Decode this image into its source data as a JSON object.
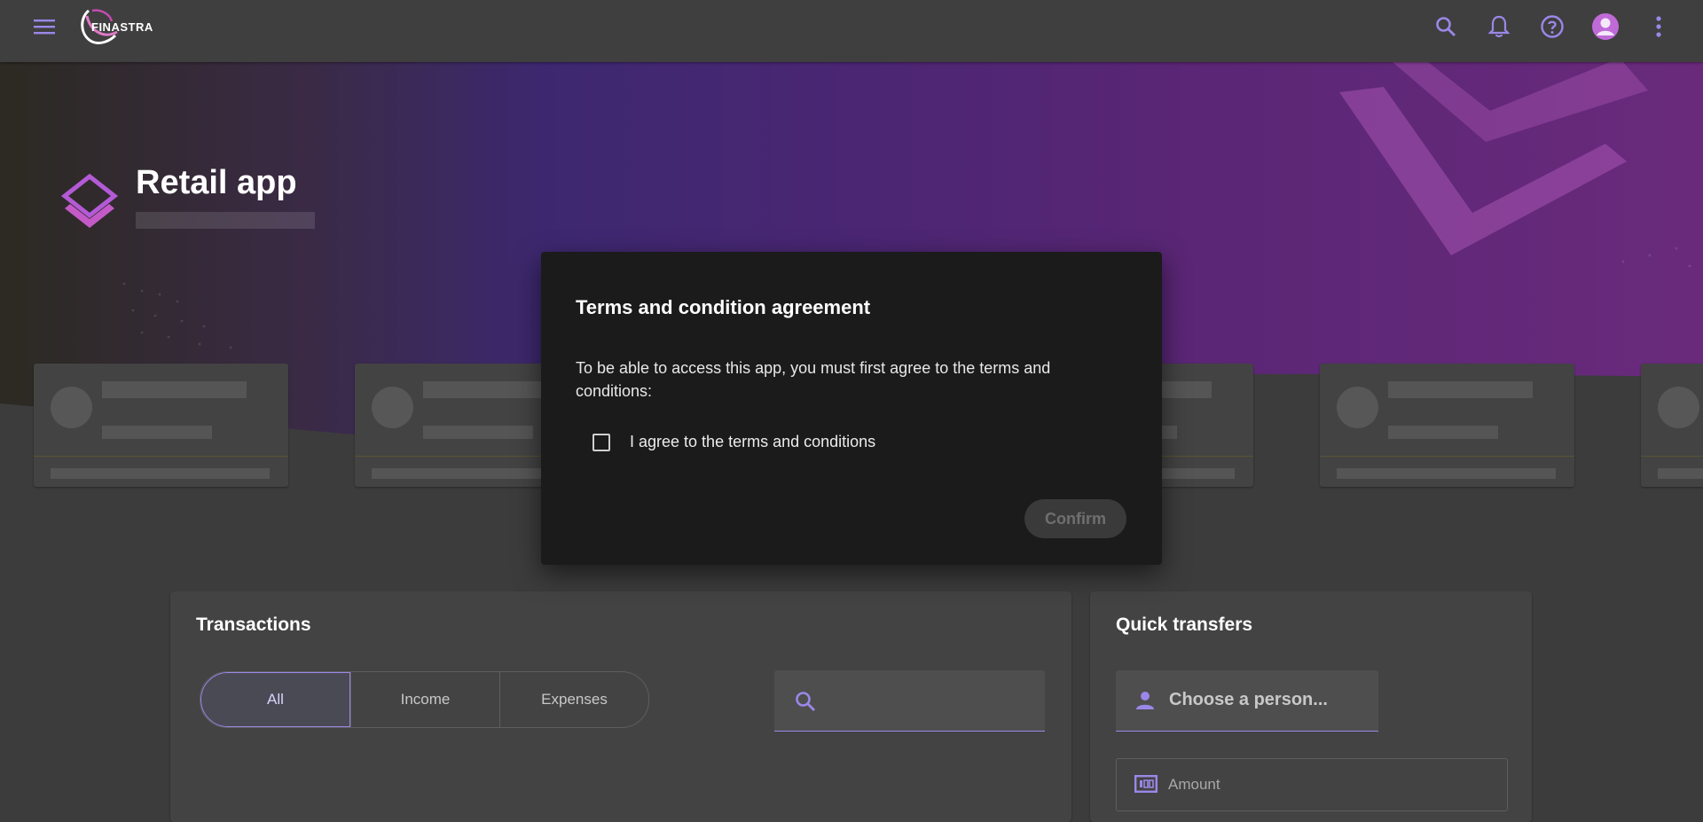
{
  "header": {
    "logo_text": "FINASTRA",
    "icons": [
      "menu-icon",
      "search-icon",
      "bell-icon",
      "help-icon",
      "account-icon",
      "more-vert-icon"
    ]
  },
  "banner": {
    "title": "Retail app"
  },
  "transactions": {
    "title": "Transactions",
    "tabs": [
      {
        "label": "All",
        "active": true
      },
      {
        "label": "Income",
        "active": false
      },
      {
        "label": "Expenses",
        "active": false
      }
    ],
    "search_placeholder": ""
  },
  "quick_transfers": {
    "title": "Quick transfers",
    "person_placeholder": "Choose a person...",
    "amount_placeholder": "Amount"
  },
  "modal": {
    "title": "Terms and condition agreement",
    "body": "To be able to access this app, you must first agree to the terms and conditions:",
    "checkbox_label": "I agree to the terms and conditions",
    "checkbox_checked": false,
    "confirm_label": "Confirm",
    "confirm_disabled": true
  },
  "colors": {
    "accent": "#9b87e8",
    "topbar": "#3f3f3f",
    "background": "#3c3c3c",
    "modal": "#1b1b1b"
  }
}
